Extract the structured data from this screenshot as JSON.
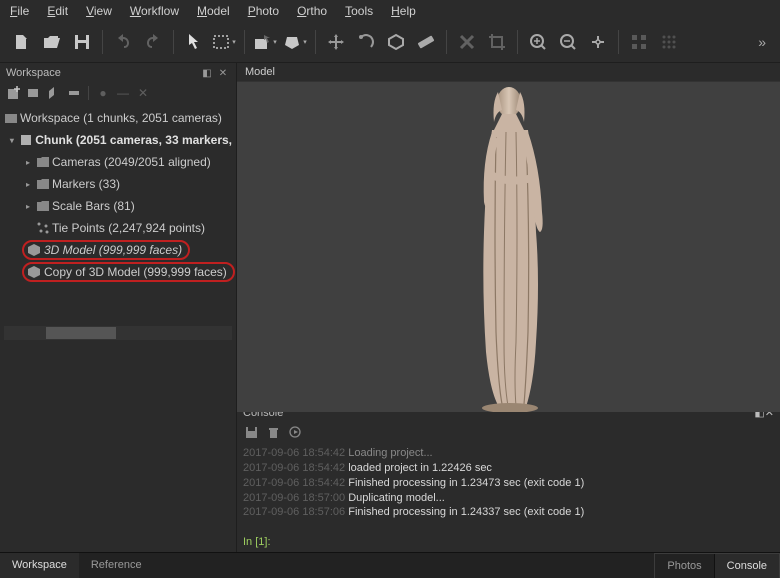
{
  "menubar": {
    "items": [
      {
        "mn": "F",
        "rest": "ile"
      },
      {
        "mn": "E",
        "rest": "dit"
      },
      {
        "mn": "V",
        "rest": "iew"
      },
      {
        "mn": "W",
        "rest": "orkflow"
      },
      {
        "mn": "M",
        "rest": "odel"
      },
      {
        "mn": "P",
        "rest": "hoto"
      },
      {
        "mn": "O",
        "rest": "rtho"
      },
      {
        "mn": "T",
        "rest": "ools"
      },
      {
        "mn": "H",
        "rest": "elp"
      }
    ]
  },
  "workspace": {
    "panel_title": "Workspace",
    "root": "Workspace (1 chunks, 2051 cameras)",
    "chunk": "Chunk (2051 cameras, 33 markers,",
    "cameras": "Cameras (2049/2051 aligned)",
    "markers": "Markers (33)",
    "scalebars": "Scale Bars (81)",
    "tiepoints": "Tie Points (2,247,924 points)",
    "model1": "3D Model (999,999 faces)",
    "model2": "Copy of 3D Model (999,999 faces)"
  },
  "model_tab": "Model",
  "console": {
    "title": "Console",
    "lines": [
      {
        "ts": "2017-09-06 18:54:42",
        "msg": "Loading project..."
      },
      {
        "ts": "2017-09-06 18:54:42",
        "msg": "loaded project in 1.22426 sec"
      },
      {
        "ts": "2017-09-06 18:54:42",
        "msg": "Finished processing in 1.23473 sec (exit code 1)"
      },
      {
        "ts": "2017-09-06 18:57:00",
        "msg": "Duplicating model..."
      },
      {
        "ts": "2017-09-06 18:57:06",
        "msg": "Finished processing in 1.24337 sec (exit code 1)"
      }
    ],
    "prompt": "In [1]:"
  },
  "status": {
    "left": [
      "Workspace",
      "Reference"
    ],
    "right": [
      "Photos",
      "Console"
    ]
  }
}
